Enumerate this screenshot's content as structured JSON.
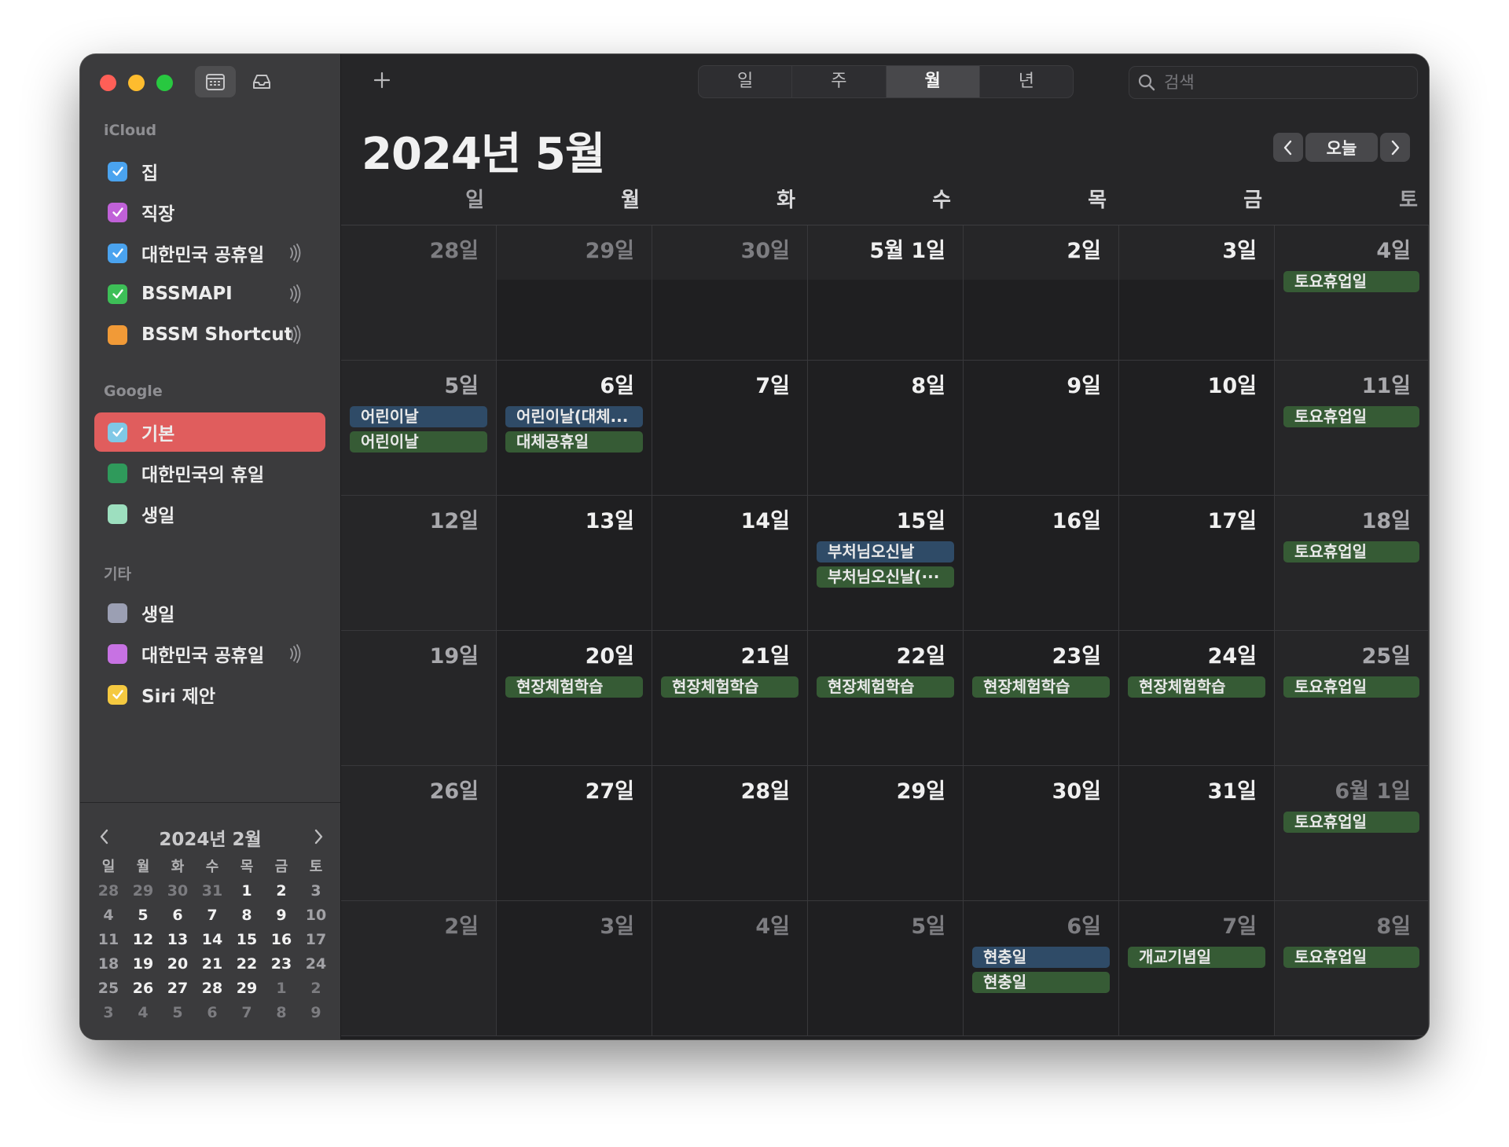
{
  "colors": {
    "selected_row": "#e05d5d",
    "event_blue": "#2f4b67",
    "event_green": "#365b35"
  },
  "sidebar": {
    "sections": [
      {
        "title": "iCloud",
        "items": [
          {
            "label": "집",
            "color": "#4aa3ef",
            "checked": true,
            "shared": false
          },
          {
            "label": "직장",
            "color": "#c061d8",
            "checked": true,
            "shared": false
          },
          {
            "label": "대한민국 공휴일",
            "color": "#4aa3ef",
            "checked": true,
            "shared": true
          },
          {
            "label": "BSSMAPI",
            "color": "#3dbf57",
            "checked": true,
            "shared": true
          },
          {
            "label": "BSSM Shortcut",
            "color": "#f19a37",
            "checked": false,
            "shared": true
          }
        ]
      },
      {
        "title": "Google",
        "items": [
          {
            "label": "기본",
            "color": "#80c8e6",
            "checked": true,
            "shared": false,
            "selected": true
          },
          {
            "label": "대한민국의 휴일",
            "color": "#2f9a5b",
            "checked": false,
            "shared": false
          },
          {
            "label": "생일",
            "color": "#9ddfbf",
            "checked": false,
            "shared": false
          }
        ]
      },
      {
        "title": "기타",
        "items": [
          {
            "label": "생일",
            "color": "#9b9fb3",
            "checked": false,
            "shared": false
          },
          {
            "label": "대한민국 공휴일",
            "color": "#c772e3",
            "checked": false,
            "shared": true
          },
          {
            "label": "Siri 제안",
            "color": "#f5c940",
            "checked": true,
            "shared": false
          }
        ]
      }
    ],
    "mini_calendar": {
      "title": "2024년 2월",
      "headers": [
        "일",
        "월",
        "화",
        "수",
        "목",
        "금",
        "토"
      ],
      "weeks": [
        [
          {
            "d": "28",
            "dim": true
          },
          {
            "d": "29",
            "dim": true
          },
          {
            "d": "30",
            "dim": true
          },
          {
            "d": "31",
            "dim": true
          },
          {
            "d": "1"
          },
          {
            "d": "2"
          },
          {
            "d": "3"
          }
        ],
        [
          {
            "d": "4"
          },
          {
            "d": "5"
          },
          {
            "d": "6"
          },
          {
            "d": "7"
          },
          {
            "d": "8"
          },
          {
            "d": "9"
          },
          {
            "d": "10"
          }
        ],
        [
          {
            "d": "11"
          },
          {
            "d": "12"
          },
          {
            "d": "13"
          },
          {
            "d": "14"
          },
          {
            "d": "15"
          },
          {
            "d": "16"
          },
          {
            "d": "17"
          }
        ],
        [
          {
            "d": "18"
          },
          {
            "d": "19"
          },
          {
            "d": "20"
          },
          {
            "d": "21"
          },
          {
            "d": "22"
          },
          {
            "d": "23"
          },
          {
            "d": "24"
          }
        ],
        [
          {
            "d": "25"
          },
          {
            "d": "26"
          },
          {
            "d": "27"
          },
          {
            "d": "28"
          },
          {
            "d": "29"
          },
          {
            "d": "1",
            "dim": true
          },
          {
            "d": "2",
            "dim": true
          }
        ],
        [
          {
            "d": "3",
            "dim": true
          },
          {
            "d": "4",
            "dim": true
          },
          {
            "d": "5",
            "dim": true
          },
          {
            "d": "6",
            "dim": true
          },
          {
            "d": "7",
            "dim": true
          },
          {
            "d": "8",
            "dim": true
          },
          {
            "d": "9",
            "dim": true
          }
        ]
      ]
    }
  },
  "toolbar": {
    "view_tabs": [
      "일",
      "주",
      "월",
      "년"
    ],
    "active_view": "월",
    "search_placeholder": "검색"
  },
  "header": {
    "title": "2024년 5월",
    "today_label": "오늘",
    "weekdays": [
      "일",
      "월",
      "화",
      "수",
      "목",
      "금",
      "토"
    ]
  },
  "weeks": [
    [
      {
        "label": "28일",
        "muted": true,
        "events": []
      },
      {
        "label": "29일",
        "muted": true,
        "events": []
      },
      {
        "label": "30일",
        "muted": true,
        "events": []
      },
      {
        "label": "5월 1일",
        "events": []
      },
      {
        "label": "2일",
        "events": []
      },
      {
        "label": "3일",
        "events": []
      },
      {
        "label": "4일",
        "events": [
          {
            "title": "토요휴업일",
            "color": "green"
          }
        ]
      }
    ],
    [
      {
        "label": "5일",
        "events": [
          {
            "title": "어린이날",
            "color": "blue"
          },
          {
            "title": "어린이날",
            "color": "green"
          }
        ]
      },
      {
        "label": "6일",
        "events": [
          {
            "title": "어린이날(대체...",
            "color": "blue"
          },
          {
            "title": "대체공휴일",
            "color": "green"
          }
        ]
      },
      {
        "label": "7일",
        "events": []
      },
      {
        "label": "8일",
        "events": []
      },
      {
        "label": "9일",
        "events": []
      },
      {
        "label": "10일",
        "events": []
      },
      {
        "label": "11일",
        "events": [
          {
            "title": "토요휴업일",
            "color": "green"
          }
        ]
      }
    ],
    [
      {
        "label": "12일",
        "events": []
      },
      {
        "label": "13일",
        "events": []
      },
      {
        "label": "14일",
        "events": []
      },
      {
        "label": "15일",
        "events": [
          {
            "title": "부처님오신날",
            "color": "blue"
          },
          {
            "title": "부처님오신날(···",
            "color": "green"
          }
        ]
      },
      {
        "label": "16일",
        "events": []
      },
      {
        "label": "17일",
        "events": []
      },
      {
        "label": "18일",
        "events": [
          {
            "title": "토요휴업일",
            "color": "green"
          }
        ]
      }
    ],
    [
      {
        "label": "19일",
        "events": []
      },
      {
        "label": "20일",
        "events": [
          {
            "title": "현장체험학습",
            "color": "green"
          }
        ]
      },
      {
        "label": "21일",
        "events": [
          {
            "title": "현장체험학습",
            "color": "green"
          }
        ]
      },
      {
        "label": "22일",
        "events": [
          {
            "title": "현장체험학습",
            "color": "green"
          }
        ]
      },
      {
        "label": "23일",
        "events": [
          {
            "title": "현장체험학습",
            "color": "green"
          }
        ]
      },
      {
        "label": "24일",
        "events": [
          {
            "title": "현장체험학습",
            "color": "green"
          }
        ]
      },
      {
        "label": "25일",
        "events": [
          {
            "title": "토요휴업일",
            "color": "green"
          }
        ]
      }
    ],
    [
      {
        "label": "26일",
        "events": []
      },
      {
        "label": "27일",
        "events": []
      },
      {
        "label": "28일",
        "events": []
      },
      {
        "label": "29일",
        "events": []
      },
      {
        "label": "30일",
        "events": []
      },
      {
        "label": "31일",
        "events": []
      },
      {
        "label": "6월 1일",
        "muted": true,
        "events": [
          {
            "title": "토요휴업일",
            "color": "green"
          }
        ]
      }
    ],
    [
      {
        "label": "2일",
        "muted": true,
        "events": []
      },
      {
        "label": "3일",
        "muted": true,
        "events": []
      },
      {
        "label": "4일",
        "muted": true,
        "events": []
      },
      {
        "label": "5일",
        "muted": true,
        "events": []
      },
      {
        "label": "6일",
        "muted": true,
        "events": [
          {
            "title": "현충일",
            "color": "blue"
          },
          {
            "title": "현충일",
            "color": "green"
          }
        ]
      },
      {
        "label": "7일",
        "muted": true,
        "events": [
          {
            "title": "개교기념일",
            "color": "green"
          }
        ]
      },
      {
        "label": "8일",
        "muted": true,
        "events": [
          {
            "title": "토요휴업일",
            "color": "green"
          }
        ]
      }
    ]
  ]
}
